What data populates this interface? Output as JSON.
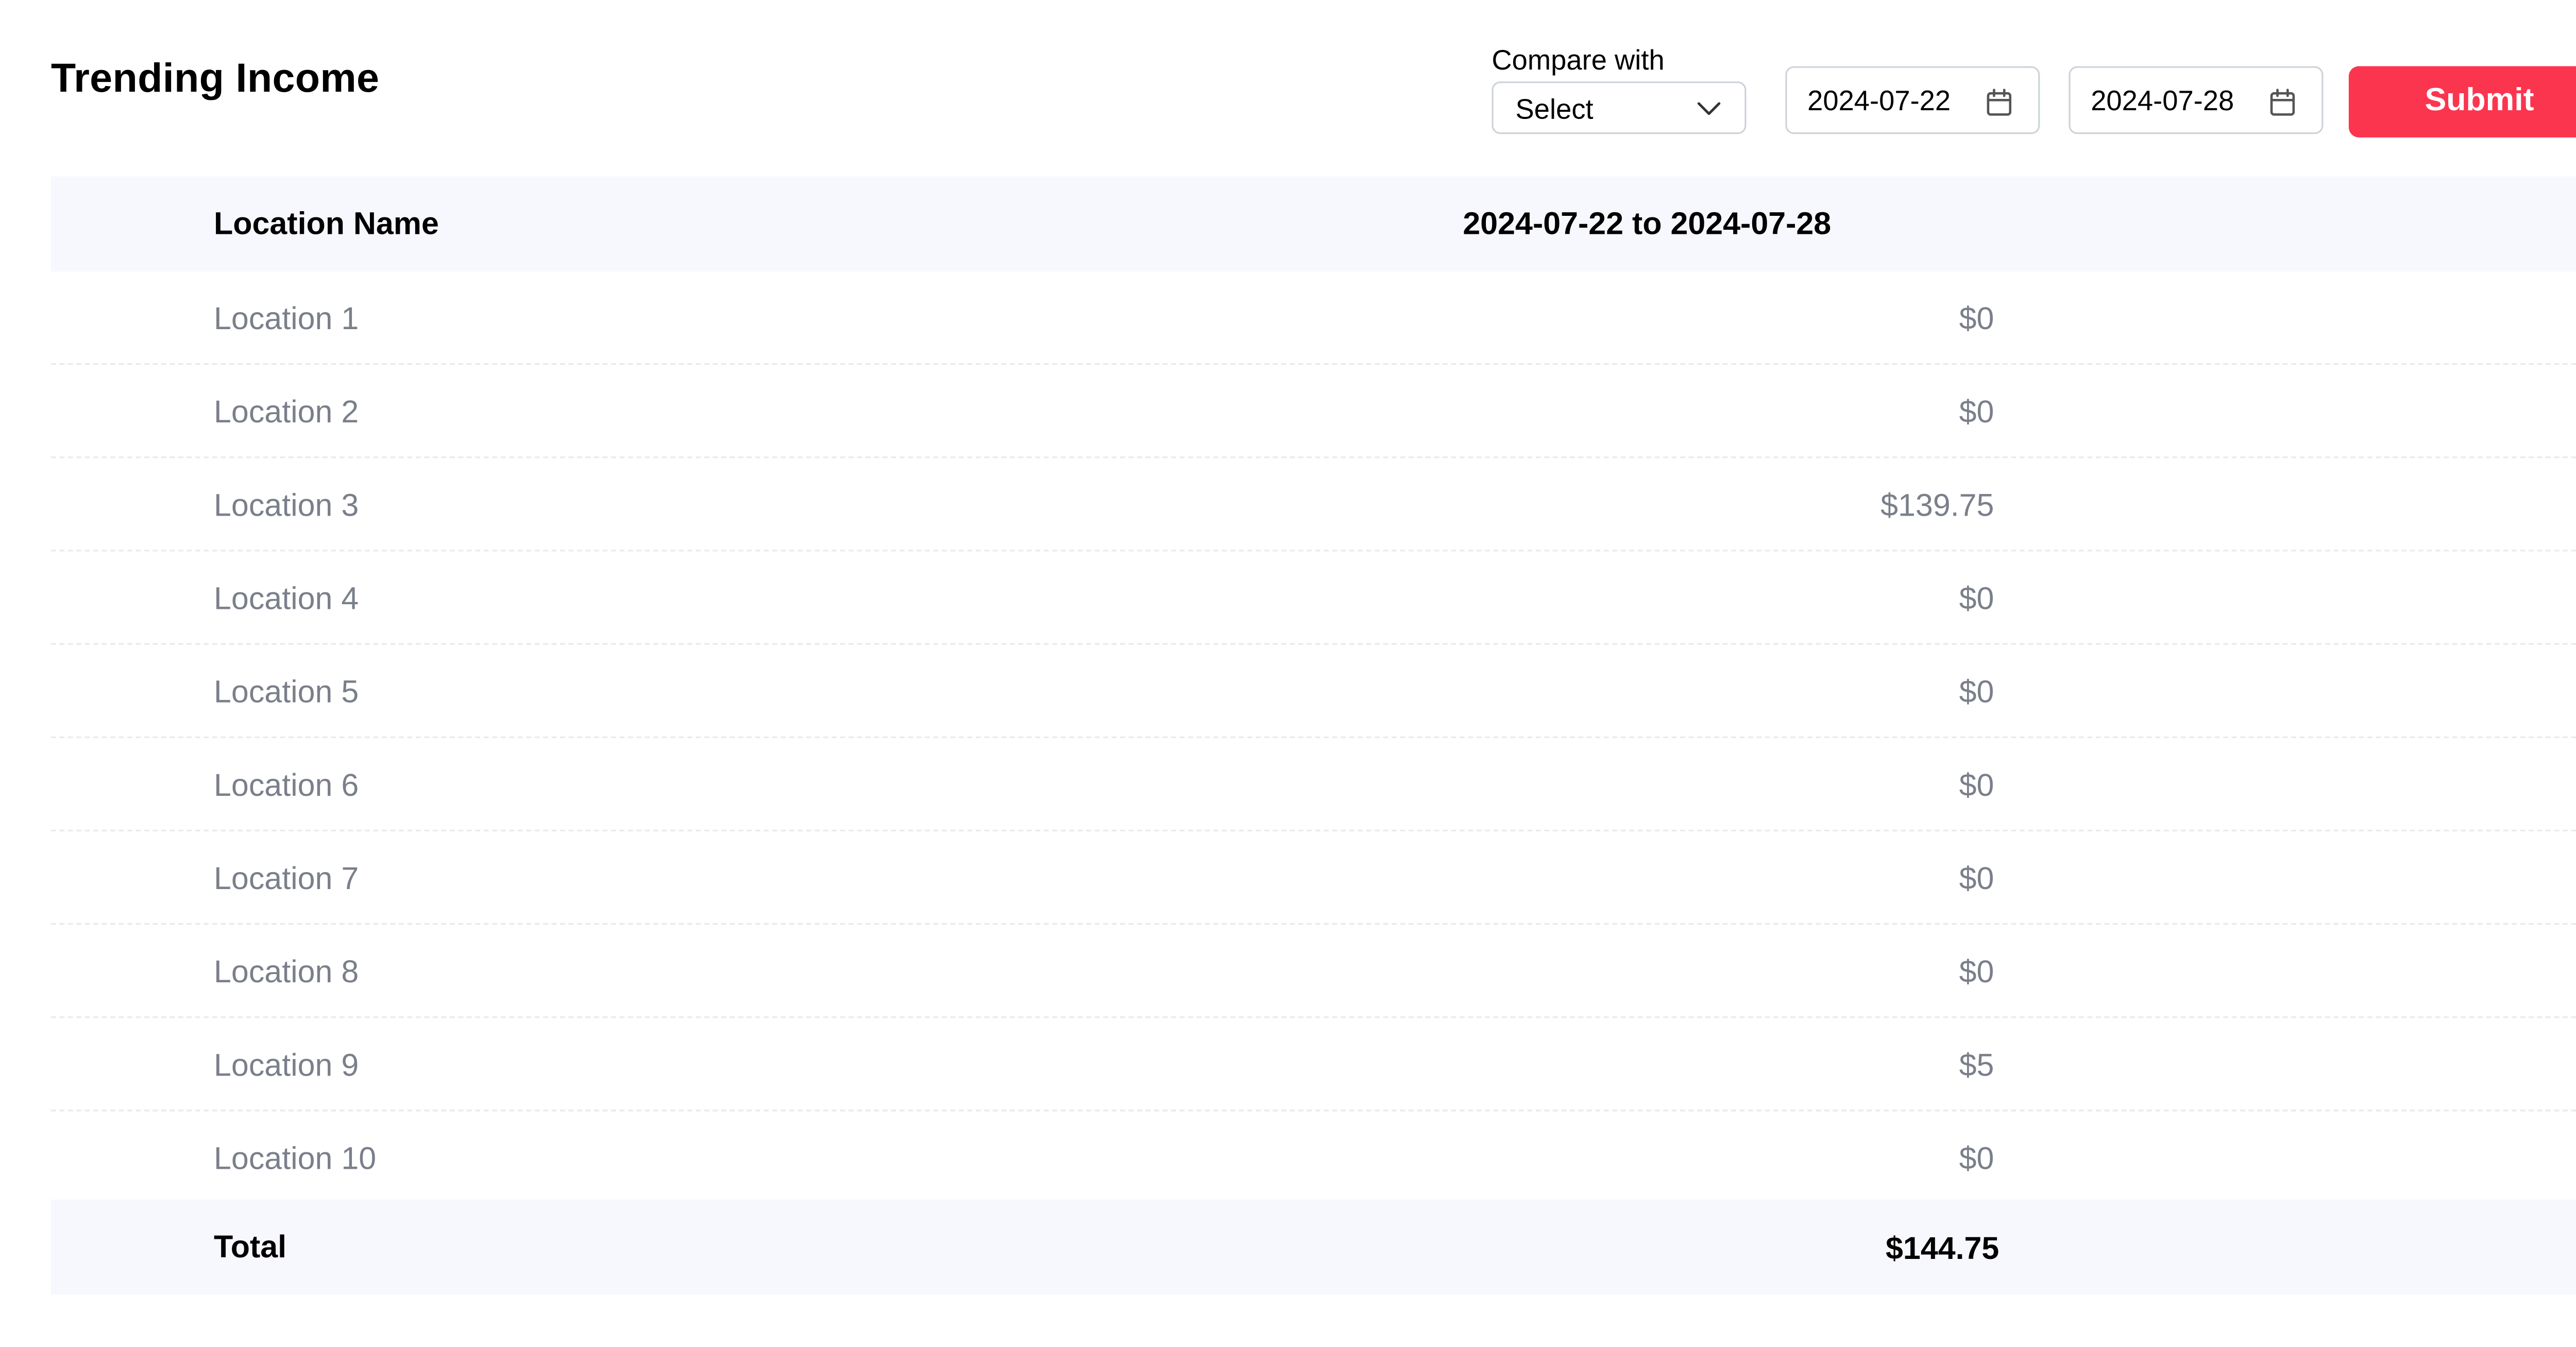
{
  "page": {
    "title": "Trending Income"
  },
  "filters": {
    "compare_label": "Compare with",
    "compare_select_value": "Select",
    "start_date": "2024-07-22",
    "end_date": "2024-07-28",
    "submit_label": "Submit"
  },
  "table": {
    "columns": [
      "Location Name",
      "2024-07-22 to 2024-07-28"
    ],
    "rows": [
      {
        "name": "Location 1",
        "value": "$0"
      },
      {
        "name": "Location 2",
        "value": "$0"
      },
      {
        "name": "Location 3",
        "value": "$139.75"
      },
      {
        "name": "Location 4",
        "value": "$0"
      },
      {
        "name": "Location 5",
        "value": "$0"
      },
      {
        "name": "Location 6",
        "value": "$0"
      },
      {
        "name": "Location 7",
        "value": "$0"
      },
      {
        "name": "Location 8",
        "value": "$0"
      },
      {
        "name": "Location 9",
        "value": "$5"
      },
      {
        "name": "Location 10",
        "value": "$0"
      }
    ],
    "total_label": "Total",
    "total_value": "$144.75"
  },
  "icons": {
    "select_chevron": "chevron-down-icon",
    "date_picker": "calendar-icon"
  },
  "colors": {
    "accent": "#fc354f",
    "header_background": "#f7f7fe",
    "muted_text": "#7a7f8a",
    "border": "#cfd4da"
  }
}
